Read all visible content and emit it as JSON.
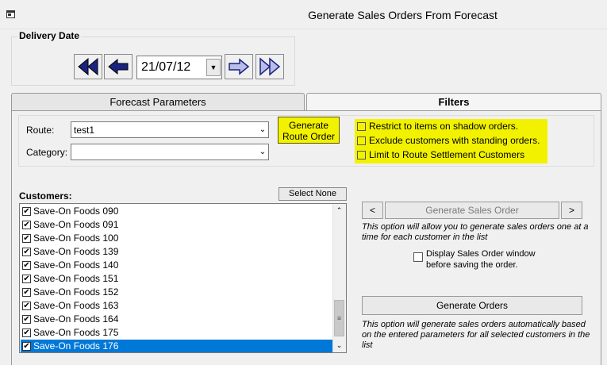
{
  "window": {
    "title": "Generate Sales Orders From Forecast"
  },
  "delivery_date": {
    "label": "Delivery Date",
    "value": "21/07/12",
    "buttons": [
      "first-date",
      "previous-date",
      "next-date",
      "last-date"
    ]
  },
  "tabs": [
    {
      "label": "Forecast Parameters",
      "active": false
    },
    {
      "label": "Filters",
      "active": true
    }
  ],
  "filters": {
    "route_label": "Route:",
    "route_value": "test1",
    "category_label": "Category:",
    "category_value": "",
    "generate_route_order_label": "Generate Route Order",
    "options": [
      {
        "label": "Restrict to items on shadow orders.",
        "checked": false
      },
      {
        "label": "Exclude customers with standing orders.",
        "checked": false
      },
      {
        "label": "Limit to Route Settlement Customers",
        "checked": false
      }
    ],
    "highlight_color": "#f2f200"
  },
  "customers": {
    "label": "Customers:",
    "select_none_label": "Select None",
    "items": [
      {
        "name": "Save-On Foods 090",
        "checked": true,
        "selected": false
      },
      {
        "name": "Save-On Foods 091",
        "checked": true,
        "selected": false
      },
      {
        "name": "Save-On Foods 100",
        "checked": true,
        "selected": false
      },
      {
        "name": "Save-On Foods 139",
        "checked": true,
        "selected": false
      },
      {
        "name": "Save-On Foods 140",
        "checked": true,
        "selected": false
      },
      {
        "name": "Save-On Foods 151",
        "checked": true,
        "selected": false
      },
      {
        "name": "Save-On Foods 152",
        "checked": true,
        "selected": false
      },
      {
        "name": "Save-On Foods 163",
        "checked": true,
        "selected": false
      },
      {
        "name": "Save-On Foods 164",
        "checked": true,
        "selected": false
      },
      {
        "name": "Save-On Foods 175",
        "checked": true,
        "selected": false
      },
      {
        "name": "Save-On Foods 176",
        "checked": true,
        "selected": true
      }
    ],
    "selection_color": "#0078d7"
  },
  "actions": {
    "prev_label": "<",
    "next_label": ">",
    "generate_sales_order_label": "Generate Sales Order",
    "one_at_a_time_note": "This option will allow you to generate sales orders one at a time for each customer in the list",
    "display_window_label": "Display Sales Order window before saving the order.",
    "display_window_checked": false,
    "generate_orders_label": "Generate Orders",
    "auto_note": "This option will generate sales orders automatically based on the entered parameters for all selected customers in the list"
  }
}
